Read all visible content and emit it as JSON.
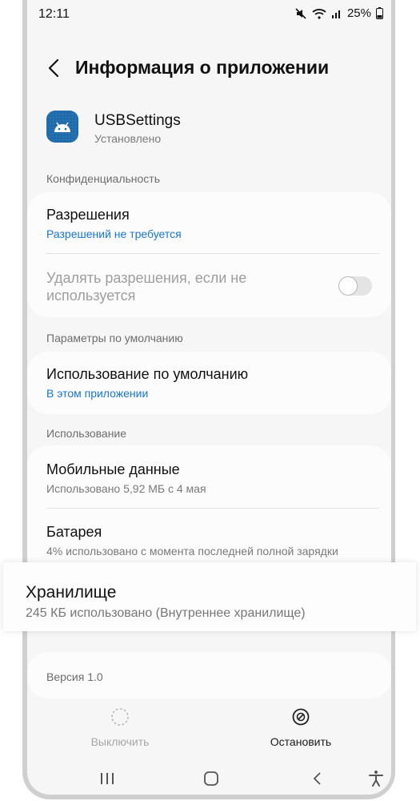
{
  "status_bar": {
    "time": "12:11",
    "battery": "25%"
  },
  "appbar": {
    "title": "Информация о приложении"
  },
  "app": {
    "name": "USBSettings",
    "state": "Установлено"
  },
  "sections": {
    "privacy": "Конфиденциальность",
    "defaults": "Параметры по умолчанию",
    "usage": "Использование"
  },
  "permissions": {
    "title": "Разрешения",
    "subtitle": "Разрешений не требуется"
  },
  "remove_permissions": {
    "title": "Удалять разрешения, если не используется"
  },
  "default_usage": {
    "title": "Использование по умолчанию",
    "subtitle": "В этом приложении"
  },
  "mobile_data": {
    "title": "Мобильные данные",
    "subtitle": "Использовано 5,92 МБ с 4 мая"
  },
  "battery": {
    "title": "Батарея",
    "subtitle": "4% использовано с момента последней полной зарядки"
  },
  "storage": {
    "title": "Хранилище",
    "subtitle": "245 КБ использовано (Внутреннее хранилище)"
  },
  "version": {
    "label": "Версия 1.0"
  },
  "actions": {
    "disable": "Выключить",
    "stop": "Остановить"
  },
  "colors": {
    "accent": "#1976d2",
    "background": "#f6f6f6",
    "android_icon": "#1e6aa8"
  }
}
